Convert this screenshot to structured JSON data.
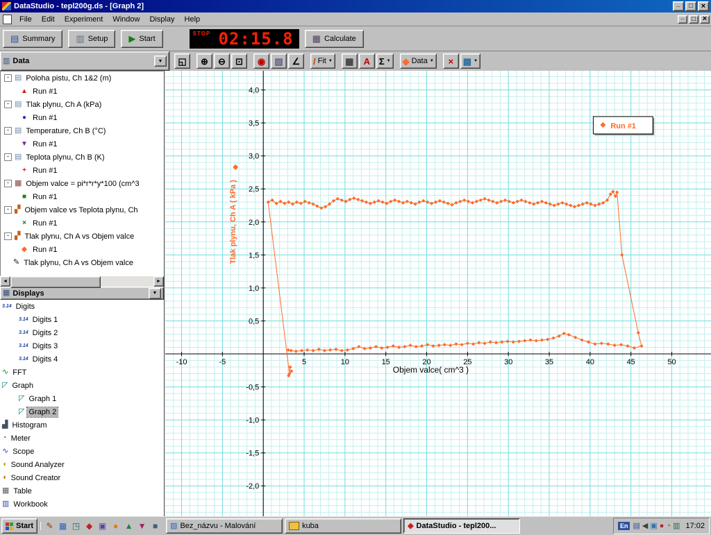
{
  "window": {
    "title": "DataStudio - tepl200g.ds - [Graph 2]",
    "menu": [
      "File",
      "Edit",
      "Experiment",
      "Window",
      "Display",
      "Help"
    ],
    "toolbar": {
      "summary": "Summary",
      "setup": "Setup",
      "start": "Start",
      "calculate": "Calculate",
      "stop_label": "STOP",
      "timer": "02:15.8"
    }
  },
  "graph_toolbar": {
    "buttons": [
      {
        "name": "scale-to-fit",
        "glyph": "◱",
        "color": "#000000"
      },
      {
        "name": "zoom-in",
        "glyph": "⊕",
        "color": "#000000",
        "gap": true
      },
      {
        "name": "zoom-out",
        "glyph": "⊖",
        "color": "#000000"
      },
      {
        "name": "zoom-select",
        "glyph": "⊡",
        "color": "#000000"
      },
      {
        "name": "smart-tool",
        "glyph": "◉",
        "color": "#c00000",
        "gap": true
      },
      {
        "name": "note-tool",
        "glyph": "▧",
        "color": "#606080"
      },
      {
        "name": "slope-tool",
        "glyph": "∠",
        "color": "#000000"
      },
      {
        "name": "fit-menu",
        "glyph": "/",
        "label": "Fit",
        "arrow": true,
        "color": "#c04000",
        "gap": true
      },
      {
        "name": "calculator",
        "glyph": "▦",
        "color": "#404040",
        "gap": true
      },
      {
        "name": "text-tool",
        "glyph": "A",
        "color": "#c00000"
      },
      {
        "name": "statistics-menu",
        "glyph": "Σ",
        "arrow": true,
        "color": "#000000"
      },
      {
        "name": "data-menu",
        "glyph": "◆",
        "label": "Data",
        "arrow": true,
        "color": "#ff6a2a",
        "gap": true
      },
      {
        "name": "delete",
        "glyph": "×",
        "color": "#cc0000",
        "gap": true
      },
      {
        "name": "graph-settings-menu",
        "glyph": "▩",
        "arrow": true,
        "color": "#3070a0"
      }
    ]
  },
  "sidebar": {
    "data_header": "Data",
    "displays_header": "Displays",
    "data_tree": [
      {
        "label": "Poloha pistu, Ch 1&2 (m)",
        "icon": "sensor",
        "level": 0,
        "exp": true
      },
      {
        "label": "Run #1",
        "marker": "triangle-up",
        "color": "#d02020",
        "level": 1
      },
      {
        "label": "Tlak plynu, Ch A (kPa)",
        "icon": "sensor",
        "level": 0,
        "exp": true
      },
      {
        "label": "Run #1",
        "marker": "circle",
        "color": "#2030c0",
        "level": 1
      },
      {
        "label": "Temperature, Ch B (°C)",
        "icon": "sensor",
        "level": 0,
        "exp": true
      },
      {
        "label": "Run #1",
        "marker": "triangle-down",
        "color": "#8020a0",
        "level": 1
      },
      {
        "label": "Teplota plynu, Ch B (K)",
        "icon": "sensor",
        "level": 0,
        "exp": true
      },
      {
        "label": "Run #1",
        "marker": "plus",
        "color": "#d02020",
        "level": 1
      },
      {
        "label": "Objem valce = pi*r*r*y*100 (cm^3",
        "icon": "calculator",
        "level": 0,
        "exp": true
      },
      {
        "label": "Run #1",
        "marker": "square",
        "color": "#208020",
        "level": 1
      },
      {
        "label": "Objem valce vs Teplota plynu, Ch",
        "icon": "xy",
        "level": 0,
        "exp": true
      },
      {
        "label": "Run #1",
        "marker": "x",
        "color": "#107040",
        "level": 1
      },
      {
        "label": "Tlak plynu, Ch A vs Objem valce",
        "icon": "xy",
        "level": 0,
        "exp": true
      },
      {
        "label": "Run #1",
        "marker": "diamond",
        "color": "#ff6a2a",
        "level": 1
      },
      {
        "label": "Tlak plynu, Ch A vs Objem valce",
        "icon": "pen",
        "level": 0,
        "exp": false
      }
    ],
    "displays_tree": [
      {
        "label": "Digits",
        "icon": "digits",
        "level": 0
      },
      {
        "label": "Digits 1",
        "icon": "digits",
        "level": 1
      },
      {
        "label": "Digits 2",
        "icon": "digits",
        "level": 1
      },
      {
        "label": "Digits 3",
        "icon": "digits",
        "level": 1
      },
      {
        "label": "Digits 4",
        "icon": "digits",
        "level": 1
      },
      {
        "label": "FFT",
        "icon": "fft",
        "level": 0
      },
      {
        "label": "Graph",
        "icon": "graph",
        "level": 0
      },
      {
        "label": "Graph 1",
        "icon": "graph",
        "level": 1
      },
      {
        "label": "Graph 2",
        "icon": "graph",
        "level": 1,
        "selected": true
      },
      {
        "label": "Histogram",
        "icon": "histogram",
        "level": 0
      },
      {
        "label": "Meter",
        "icon": "meter",
        "level": 0
      },
      {
        "label": "Scope",
        "icon": "scope",
        "level": 0
      },
      {
        "label": "Sound Analyzer",
        "icon": "sound-analyzer",
        "level": 0
      },
      {
        "label": "Sound Creator",
        "icon": "sound-creator",
        "level": 0
      },
      {
        "label": "Table",
        "icon": "table",
        "level": 0
      },
      {
        "label": "Workbook",
        "icon": "workbook",
        "level": 0
      }
    ]
  },
  "icon_glyphs": {
    "sensor": "▤",
    "calculator": "▦",
    "xy": "▞",
    "pen": "✎",
    "digits": "3.14",
    "fft": "∿",
    "graph": "◸",
    "histogram": "▟",
    "meter": "◔",
    "scope": "∿",
    "sound-analyzer": "◖",
    "sound-creator": "◖",
    "table": "▦",
    "workbook": "▥"
  },
  "icon_colors": {
    "sensor": "#7088a8",
    "calculator": "#804040",
    "xy": "#c06020",
    "pen": "#202020",
    "fft": "#00a000",
    "graph": "#008080",
    "histogram": "#405060",
    "meter": "#b06000",
    "scope": "#2040c0",
    "sound-analyzer": "#c0a000",
    "sound-creator": "#c07000",
    "table": "#606060",
    "workbook": "#3050a0"
  },
  "marker_glyphs": {
    "triangle-up": "▲",
    "circle": "●",
    "triangle-down": "▼",
    "plus": "+",
    "square": "■",
    "x": "×",
    "diamond": "◆"
  },
  "taskbar": {
    "start_label": "Start",
    "quicklaunch": [
      {
        "name": "quicklaunch-icon-1",
        "glyph": "✎",
        "color": "#804000"
      },
      {
        "name": "quicklaunch-icon-2",
        "glyph": "▦",
        "color": "#3060c0"
      },
      {
        "name": "quicklaunch-icon-3",
        "glyph": "◳",
        "color": "#207060"
      },
      {
        "name": "quicklaunch-icon-4",
        "glyph": "◆",
        "color": "#c02020"
      },
      {
        "name": "quicklaunch-icon-5",
        "glyph": "▣",
        "color": "#6040a0"
      },
      {
        "name": "quicklaunch-icon-6",
        "glyph": "●",
        "color": "#e08000"
      },
      {
        "name": "quicklaunch-icon-7",
        "glyph": "▲",
        "color": "#208040"
      },
      {
        "name": "quicklaunch-icon-8",
        "glyph": "▼",
        "color": "#a02060"
      },
      {
        "name": "quicklaunch-icon-9",
        "glyph": "■",
        "color": "#406080"
      }
    ],
    "tasks": [
      {
        "label": "Bez_názvu - Malování",
        "icon": "paint",
        "active": false
      },
      {
        "label": "kuba",
        "icon": "folder",
        "active": false
      },
      {
        "label": "DataStudio - tepl200...",
        "icon": "datastudio",
        "active": true
      }
    ],
    "tray_lang": "En",
    "tray_icons": [
      {
        "name": "keyboard-layout-icon",
        "glyph": "▤",
        "color": "#3050a0"
      },
      {
        "name": "volume-icon",
        "glyph": "◀",
        "color": "#404040"
      },
      {
        "name": "display-settings-icon",
        "glyph": "▣",
        "color": "#3070b0"
      },
      {
        "name": "antivirus-icon",
        "glyph": "●",
        "color": "#c02020"
      },
      {
        "name": "scheduler-icon",
        "glyph": "◔",
        "color": "#806020"
      },
      {
        "name": "network-icon",
        "glyph": "▥",
        "color": "#207040"
      }
    ],
    "clock": "17:02"
  },
  "chart_data": {
    "type": "scatter",
    "xlabel": "Objem valce( cm^3 )",
    "ylabel": "Tlak plynu, Ch A ( kPa )",
    "xlim": [
      -12,
      54.8
    ],
    "ylim": [
      -2.46,
      4.29
    ],
    "x_ticks": [
      -10,
      -5,
      0,
      5,
      10,
      15,
      20,
      25,
      30,
      35,
      40,
      45,
      50
    ],
    "x_tick_labels": [
      "-10",
      "-5",
      "",
      "5",
      "10",
      "15",
      "20",
      "25",
      "30",
      "35",
      "40",
      "45",
      "50"
    ],
    "y_ticks": [
      -2,
      -1.5,
      -1,
      -0.5,
      0,
      0.5,
      1,
      1.5,
      2,
      2.5,
      3,
      3.5,
      4
    ],
    "y_tick_labels": [
      "-2,0",
      "-1,5",
      "-1,0",
      "-0,5",
      "",
      "0,5",
      "1,0",
      "1,5",
      "2,0",
      "2,5",
      "3,0",
      "3,5",
      "4,0"
    ],
    "grid": {
      "minor_x": 1,
      "minor_y": 0.1,
      "major_x": 5,
      "major_y": 0.5,
      "minor_color": "#c2efed",
      "major_color": "#6edede"
    },
    "series_color": "#ff6a2a",
    "legend": {
      "label": "Run #1",
      "marker": "diamond"
    },
    "points": [
      [
        3.3,
        -0.2
      ],
      [
        3.1,
        -0.33
      ],
      [
        3.45,
        -0.26
      ],
      [
        3.2,
        -0.3
      ],
      [
        0.6,
        2.3
      ],
      [
        1.1,
        2.33
      ],
      [
        1.6,
        2.28
      ],
      [
        2.1,
        2.31
      ],
      [
        2.6,
        2.28
      ],
      [
        3.1,
        2.3
      ],
      [
        3.6,
        2.27
      ],
      [
        4.1,
        2.3
      ],
      [
        4.6,
        2.28
      ],
      [
        5.1,
        2.31
      ],
      [
        5.6,
        2.29
      ],
      [
        6.1,
        2.27
      ],
      [
        6.6,
        2.24
      ],
      [
        7.1,
        2.21
      ],
      [
        7.6,
        2.23
      ],
      [
        8.1,
        2.27
      ],
      [
        8.6,
        2.32
      ],
      [
        9.1,
        2.35
      ],
      [
        9.6,
        2.33
      ],
      [
        10.1,
        2.31
      ],
      [
        10.6,
        2.34
      ],
      [
        11.1,
        2.36
      ],
      [
        11.6,
        2.34
      ],
      [
        12.1,
        2.32
      ],
      [
        12.6,
        2.3
      ],
      [
        13.1,
        2.28
      ],
      [
        13.6,
        2.3
      ],
      [
        14.1,
        2.32
      ],
      [
        14.6,
        2.3
      ],
      [
        15.1,
        2.28
      ],
      [
        15.6,
        2.31
      ],
      [
        16.1,
        2.33
      ],
      [
        16.6,
        2.31
      ],
      [
        17.1,
        2.29
      ],
      [
        17.6,
        2.31
      ],
      [
        18.1,
        2.29
      ],
      [
        18.6,
        2.27
      ],
      [
        19.1,
        2.3
      ],
      [
        19.6,
        2.32
      ],
      [
        20.1,
        2.3
      ],
      [
        20.6,
        2.28
      ],
      [
        21.1,
        2.3
      ],
      [
        21.6,
        2.32
      ],
      [
        22.1,
        2.3
      ],
      [
        22.6,
        2.28
      ],
      [
        23.1,
        2.26
      ],
      [
        23.6,
        2.29
      ],
      [
        24.1,
        2.31
      ],
      [
        24.6,
        2.33
      ],
      [
        25.1,
        2.31
      ],
      [
        25.6,
        2.29
      ],
      [
        26.1,
        2.31
      ],
      [
        26.6,
        2.33
      ],
      [
        27.1,
        2.35
      ],
      [
        27.6,
        2.33
      ],
      [
        28.1,
        2.31
      ],
      [
        28.6,
        2.29
      ],
      [
        29.1,
        2.31
      ],
      [
        29.6,
        2.33
      ],
      [
        30.1,
        2.31
      ],
      [
        30.6,
        2.29
      ],
      [
        31.1,
        2.31
      ],
      [
        31.6,
        2.33
      ],
      [
        32.1,
        2.31
      ],
      [
        32.6,
        2.29
      ],
      [
        33.1,
        2.27
      ],
      [
        33.6,
        2.29
      ],
      [
        34.1,
        2.31
      ],
      [
        34.6,
        2.29
      ],
      [
        35.1,
        2.27
      ],
      [
        35.6,
        2.25
      ],
      [
        36.1,
        2.27
      ],
      [
        36.6,
        2.29
      ],
      [
        37.1,
        2.27
      ],
      [
        37.6,
        2.25
      ],
      [
        38.1,
        2.23
      ],
      [
        38.6,
        2.25
      ],
      [
        39.1,
        2.27
      ],
      [
        39.6,
        2.29
      ],
      [
        40.1,
        2.27
      ],
      [
        40.6,
        2.25
      ],
      [
        41.1,
        2.27
      ],
      [
        41.6,
        2.29
      ],
      [
        42.1,
        2.33
      ],
      [
        42.5,
        2.42
      ],
      [
        42.8,
        2.46
      ],
      [
        43.1,
        2.39
      ],
      [
        43.3,
        2.45
      ],
      [
        43.9,
        1.5
      ],
      [
        45.9,
        0.32
      ],
      [
        46.3,
        0.12
      ],
      [
        45.4,
        0.09
      ],
      [
        44.6,
        0.12
      ],
      [
        43.8,
        0.14
      ],
      [
        43,
        0.13
      ],
      [
        42.2,
        0.15
      ],
      [
        41.4,
        0.16
      ],
      [
        40.6,
        0.15
      ],
      [
        39.8,
        0.18
      ],
      [
        39,
        0.21
      ],
      [
        38.2,
        0.25
      ],
      [
        37.4,
        0.29
      ],
      [
        36.8,
        0.31
      ],
      [
        36.2,
        0.27
      ],
      [
        35.5,
        0.24
      ],
      [
        34.8,
        0.22
      ],
      [
        34.1,
        0.21
      ],
      [
        33.4,
        0.2
      ],
      [
        32.7,
        0.21
      ],
      [
        32,
        0.2
      ],
      [
        31.3,
        0.19
      ],
      [
        30.6,
        0.18
      ],
      [
        29.9,
        0.19
      ],
      [
        29.2,
        0.18
      ],
      [
        28.5,
        0.17
      ],
      [
        27.8,
        0.18
      ],
      [
        27.1,
        0.16
      ],
      [
        26.4,
        0.17
      ],
      [
        25.7,
        0.15
      ],
      [
        25,
        0.16
      ],
      [
        24.3,
        0.14
      ],
      [
        23.6,
        0.15
      ],
      [
        22.9,
        0.13
      ],
      [
        22.2,
        0.14
      ],
      [
        21.5,
        0.13
      ],
      [
        20.8,
        0.12
      ],
      [
        20.1,
        0.14
      ],
      [
        19.4,
        0.12
      ],
      [
        18.7,
        0.11
      ],
      [
        18,
        0.13
      ],
      [
        17.3,
        0.11
      ],
      [
        16.6,
        0.1
      ],
      [
        15.9,
        0.12
      ],
      [
        15.2,
        0.1
      ],
      [
        14.5,
        0.09
      ],
      [
        13.8,
        0.11
      ],
      [
        13.1,
        0.09
      ],
      [
        12.4,
        0.08
      ],
      [
        11.7,
        0.11
      ],
      [
        11,
        0.08
      ],
      [
        10.3,
        0.06
      ],
      [
        9.6,
        0.05
      ],
      [
        8.9,
        0.07
      ],
      [
        8.2,
        0.06
      ],
      [
        7.5,
        0.05
      ],
      [
        6.8,
        0.07
      ],
      [
        6.1,
        0.05
      ],
      [
        5.4,
        0.06
      ],
      [
        4.7,
        0.05
      ],
      [
        4,
        0.04
      ],
      [
        3.4,
        0.05
      ],
      [
        3.05,
        0.06
      ]
    ]
  }
}
